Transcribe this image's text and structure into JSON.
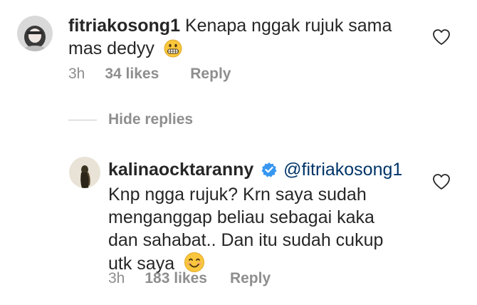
{
  "comment": {
    "username": "fitriakosong1",
    "text_line1": "Kenapa nggak rujuk sama",
    "text_line2": "mas dedyy",
    "time": "3h",
    "likes": "34 likes",
    "reply": "Reply",
    "emoji": "grimacing-face-icon"
  },
  "replies_toggle": {
    "label": "Hide replies"
  },
  "reply": {
    "username": "kalinaocktaranny",
    "mention": "@fitriakosong1",
    "text_line1": "Knp ngga rujuk? Krn saya sudah",
    "text_line2": "menganggap beliau sebagai kaka",
    "text_line3": "dan sahabat.. Dan itu sudah cukup",
    "text_line4": "utk saya",
    "time": "3h",
    "likes": "183 likes",
    "reply": "Reply",
    "emoji": "smiling-face-icon"
  },
  "colors": {
    "verified": "#3897f0",
    "mention": "#003569",
    "meta": "#8e8e8e",
    "emoji": "#f9c63c"
  }
}
